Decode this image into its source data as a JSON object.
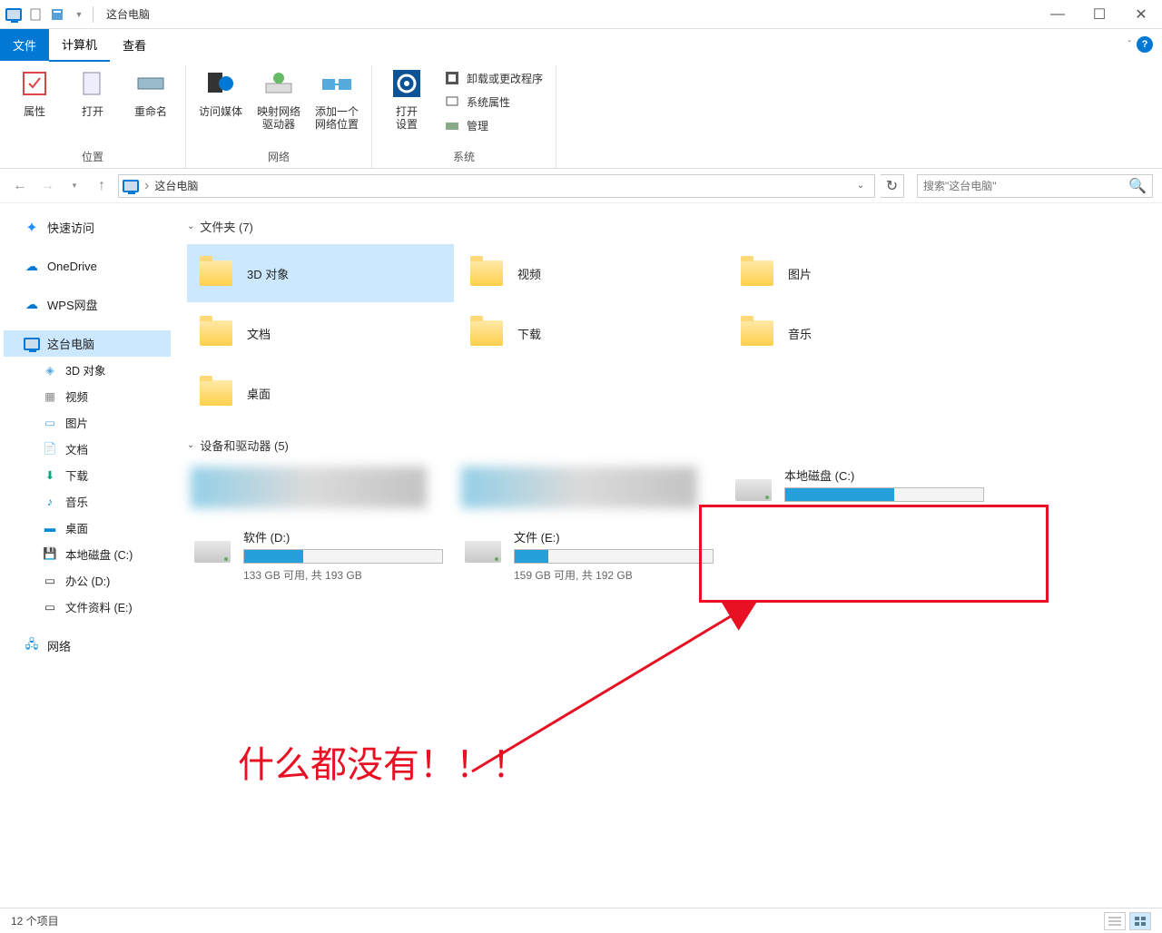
{
  "window": {
    "title": "这台电脑"
  },
  "ribbon_tabs": {
    "file": "文件",
    "computer": "计算机",
    "view": "查看"
  },
  "ribbon": {
    "group1": {
      "label": "位置",
      "properties": "属性",
      "open": "打开",
      "rename": "重命名"
    },
    "group2": {
      "label": "网络",
      "access_media": "访问媒体",
      "map_drive": "映射网络\n驱动器",
      "add_location": "添加一个\n网络位置"
    },
    "group3": {
      "label": "系统",
      "open_settings": "打开\n设置",
      "uninstall": "卸载或更改程序",
      "sys_props": "系统属性",
      "manage": "管理"
    }
  },
  "breadcrumb": {
    "root": "这台电脑"
  },
  "search": {
    "placeholder": "搜索\"这台电脑\""
  },
  "nav": {
    "quick_access": "快速访问",
    "onedrive": "OneDrive",
    "wps": "WPS网盘",
    "this_pc": "这台电脑",
    "sub_3d": "3D 对象",
    "sub_video": "视频",
    "sub_pictures": "图片",
    "sub_docs": "文档",
    "sub_download": "下载",
    "sub_music": "音乐",
    "sub_desktop": "桌面",
    "sub_c": "本地磁盘 (C:)",
    "sub_d": "办公 (D:)",
    "sub_e": "文件资料 (E:)",
    "network": "网络"
  },
  "sections": {
    "folders_header": "文件夹 (7)",
    "devices_header": "设备和驱动器 (5)"
  },
  "folders": {
    "f0": "3D 对象",
    "f1": "视频",
    "f2": "图片",
    "f3": "文档",
    "f4": "下载",
    "f5": "音乐",
    "f6": "桌面"
  },
  "drives": {
    "c_name": "本地磁盘 (C:)",
    "d_name": "软件 (D:)",
    "d_text": "133 GB 可用, 共 193 GB",
    "d_fill_pct": "30",
    "e_name": "文件 (E:)",
    "e_text": "159 GB 可用, 共 192 GB",
    "e_fill_pct": "17"
  },
  "annotations": {
    "text": "什么都没有！！！"
  },
  "status": {
    "count": "12 个项目"
  }
}
